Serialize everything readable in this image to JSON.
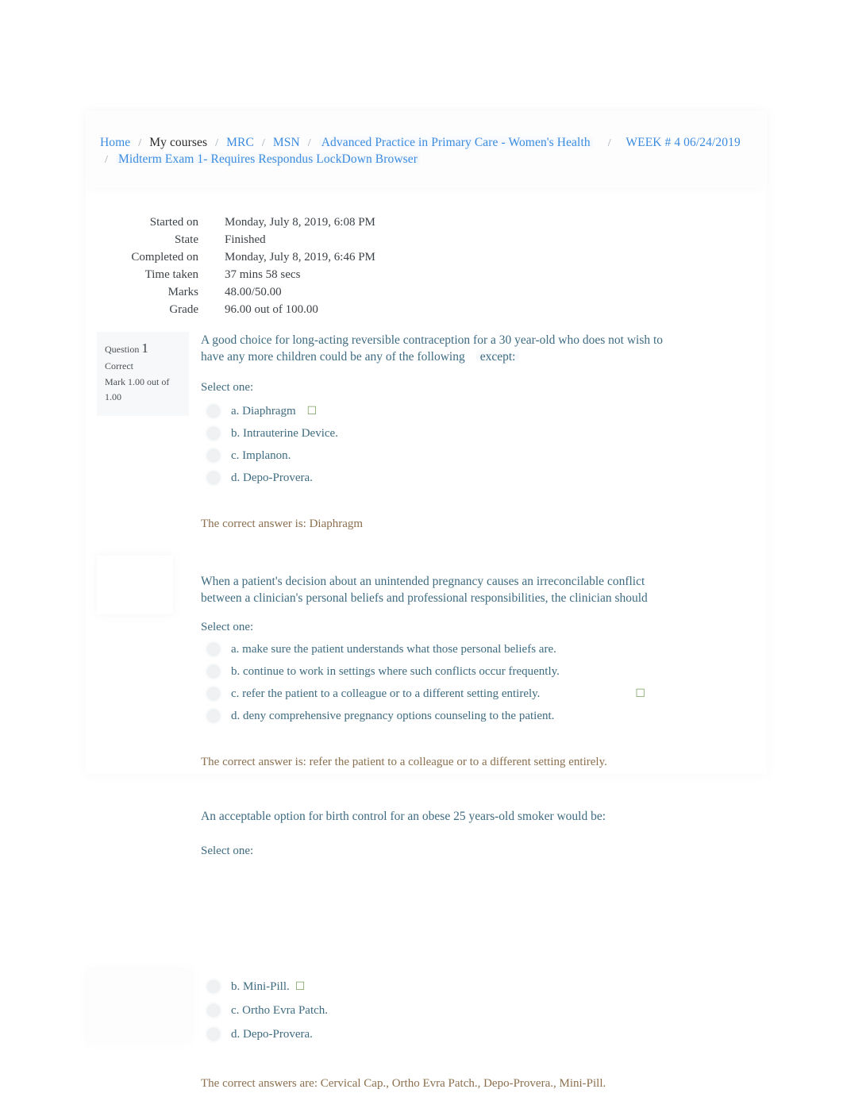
{
  "breadcrumb": {
    "separator": "/",
    "items": [
      {
        "label": "Home",
        "link": true
      },
      {
        "label": "My courses",
        "link": false
      },
      {
        "label": "MRC",
        "link": true
      },
      {
        "label": "MSN",
        "link": true
      },
      {
        "label": "Advanced Practice in Primary Care - Women's Health",
        "link": true
      },
      {
        "label": "WEEK # 4 06/24/2019",
        "link": true
      },
      {
        "label": "Midterm Exam 1- Requires Respondus LockDown Browser",
        "link": true
      }
    ]
  },
  "quiz_summary": {
    "rows": [
      {
        "label": "Started on",
        "value": "Monday, July 8, 2019, 6:08 PM"
      },
      {
        "label": "State",
        "value": "Finished"
      },
      {
        "label": "Completed on",
        "value": "Monday, July 8, 2019, 6:46 PM"
      },
      {
        "label": "Time taken",
        "value": "37 mins 58 secs"
      },
      {
        "label": "Marks",
        "value": "48.00/50.00"
      },
      {
        "label": "Grade",
        "value": "96.00  out of 100.00"
      }
    ]
  },
  "questions": [
    {
      "info": {
        "question_label": "Question",
        "number": "1",
        "state": "Correct",
        "grade": "Mark 1.00 out of 1.00"
      },
      "text_part1": "A good choice for long-acting reversible contraception for a 30 year-old who does not wish to have any more children could be any of the following",
      "text_emphasis": "except:",
      "select_label": "Select one:",
      "options": [
        {
          "label": "a. Diaphragm",
          "selected": true,
          "tick": "☐"
        },
        {
          "label": "b. Intrauterine Device.",
          "selected": false,
          "tick": ""
        },
        {
          "label": "c. Implanon.",
          "selected": false,
          "tick": ""
        },
        {
          "label": "d. Depo-Provera.",
          "selected": false,
          "tick": ""
        }
      ],
      "correct_answer": "The correct answer is: Diaphragm"
    },
    {
      "info": {
        "question_label": "",
        "number": "",
        "state": "",
        "grade": ""
      },
      "text_part1": "When a patient's decision about an unintended pregnancy causes an irreconcilable conflict between a clinician's personal beliefs and professional responsibilities, the clinician should",
      "text_emphasis": "",
      "select_label": "Select one:",
      "options": [
        {
          "label": "a. make sure the patient understands what those personal beliefs are.",
          "selected": false,
          "tick": ""
        },
        {
          "label": "b. continue to work in settings where such conflicts occur frequently.",
          "selected": false,
          "tick": ""
        },
        {
          "label": "c. refer the patient to a colleague or to a different setting entirely.",
          "selected": true,
          "tick": "☐"
        },
        {
          "label": "d. deny comprehensive pregnancy options counseling to the patient.",
          "selected": false,
          "tick": ""
        }
      ],
      "correct_answer": "The correct answer is: refer the patient to a colleague or to a different setting entirely."
    },
    {
      "info": {
        "question_label": "",
        "number": "",
        "state": "",
        "grade": ""
      },
      "text_part1": "An acceptable option for birth control for an obese 25 years-old smoker would be:",
      "text_emphasis": "",
      "select_label": "Select one:",
      "options": [
        {
          "label": "b. Mini-Pill.",
          "selected": true,
          "tick": "☐"
        },
        {
          "label": "c. Ortho Evra Patch.",
          "selected": false,
          "tick": ""
        },
        {
          "label": "d. Depo-Provera.",
          "selected": false,
          "tick": ""
        }
      ],
      "correct_answer": "The correct answers are: Cervical Cap., Ortho Evra Patch., Depo-Provera., Mini-Pill."
    }
  ],
  "colors": {
    "link": "#3b8ce0",
    "question_text": "#3e6b80",
    "correct_answer_text": "#8b6f4e",
    "tick_green": "#7aa05e",
    "info_box_bg": "#f7f8f9",
    "page_bg": "#ffffff"
  }
}
